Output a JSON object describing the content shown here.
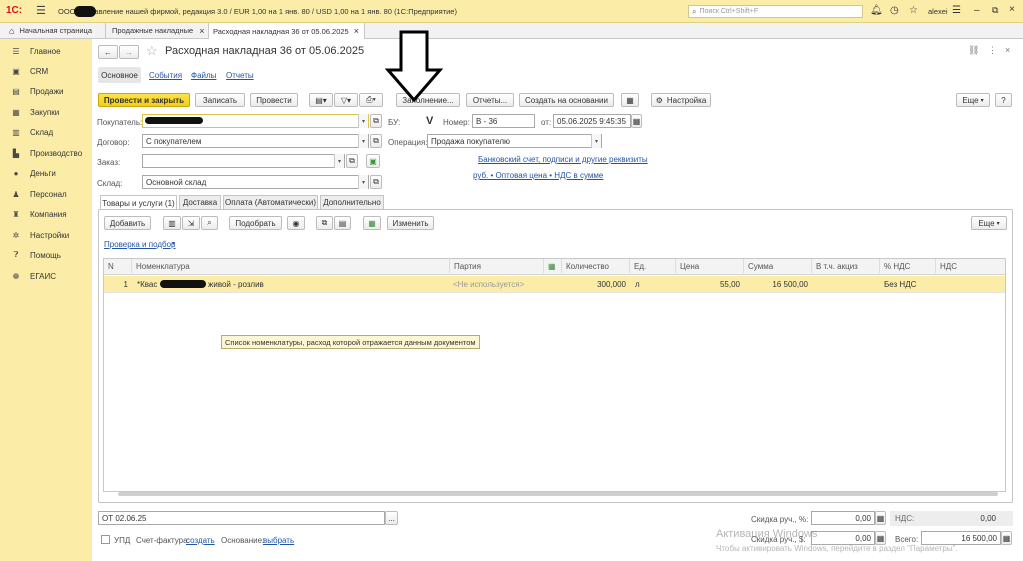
{
  "app": {
    "logo": "1С:",
    "title": "ООО  / Управление нашей фирмой, редакция 3.0 / EUR 1,00 на 1 янв. 80 / USD 1,00 на 1 янв. 80  (1С:Предприятие)",
    "search_placeholder": "Поиск Ctrl+Shift+F",
    "user": "alexei"
  },
  "tabs": [
    {
      "label": "Начальная страница"
    },
    {
      "label": "Продажные накладные"
    },
    {
      "label": "Расходная накладная 36 от 05.06.2025"
    }
  ],
  "sidebar": {
    "items": [
      {
        "label": "Главное",
        "icon": "menu-icon"
      },
      {
        "label": "CRM",
        "icon": "crm-icon"
      },
      {
        "label": "Продажи",
        "icon": "sales-icon"
      },
      {
        "label": "Закупки",
        "icon": "purchases-icon"
      },
      {
        "label": "Склад",
        "icon": "warehouse-icon"
      },
      {
        "label": "Производство",
        "icon": "production-icon"
      },
      {
        "label": "Деньги",
        "icon": "money-icon"
      },
      {
        "label": "Персонал",
        "icon": "staff-icon"
      },
      {
        "label": "Компания",
        "icon": "company-icon"
      },
      {
        "label": "Настройки",
        "icon": "settings-icon"
      },
      {
        "label": "Помощь",
        "icon": "help-icon"
      },
      {
        "label": "ЕГАИС",
        "icon": "egais-icon"
      }
    ]
  },
  "doc": {
    "title": "Расходная накладная 36 от 05.06.2025",
    "nav": {
      "main": "Основное",
      "events": "События",
      "files": "Файлы",
      "reports": "Отчеты"
    },
    "toolbar": {
      "post_close": "Провести и закрыть",
      "save": "Записать",
      "post": "Провести",
      "fill": "Заполнение...",
      "reports": "Отчеты...",
      "create_based": "Создать на основании",
      "settings": "Настройка",
      "more": "Еще",
      "help": "?"
    },
    "fields": {
      "buyer_label": "Покупатель:",
      "contract_label": "Договор:",
      "contract_value": "С покупателем",
      "order_label": "Заказ:",
      "warehouse_label": "Склад:",
      "warehouse_value": "Основной склад",
      "bu_label": "БУ:",
      "bu_check": "V",
      "number_label": "Номер:",
      "number_value": "В - 36",
      "date_label": "от:",
      "date_value": "05.06.2025  9:45:35",
      "operation_label": "Операция:",
      "operation_value": "Продажа покупателю",
      "bank_link": "Банковский счет, подписи и другие реквизиты",
      "price_link": "руб. • Оптовая цена • НДС в сумме"
    },
    "content_tabs": [
      {
        "label": "Товары и услуги (1)"
      },
      {
        "label": "Доставка"
      },
      {
        "label": "Оплата (Автоматически)"
      },
      {
        "label": "Дополнительно"
      }
    ],
    "table_toolbar": {
      "add": "Добавить",
      "pick": "Подобрать",
      "change": "Изменить",
      "more": "Еще",
      "check_link": "Проверка и подбор"
    },
    "table": {
      "headers": [
        "N",
        "Номенклатура",
        "Партия",
        "",
        "Количество",
        "Ед.",
        "Цена",
        "Сумма",
        "В т.ч. акциз",
        "% НДС",
        "НДС"
      ],
      "rows": [
        {
          "n": "1",
          "item": "*Квас",
          "item_rest": "живой - розлив",
          "batch": "<Не используется>",
          "qty": "300,000",
          "unit": "л",
          "price": "55,00",
          "sum": "16 500,00",
          "excise": "",
          "vat_rate": "Без НДС",
          "vat": ""
        }
      ]
    },
    "tooltip": "Список номенклатуры, расход которой отражается данным документом",
    "footer": {
      "comment": "ОТ 02.06.25",
      "upd_label": "УПД",
      "invoice_label": "Счет-фактура:",
      "invoice_link": "создать",
      "basis_label": "Основание:",
      "basis_link": "выбрать",
      "discount_pct_label": "Скидка руч., %:",
      "discount_pct_value": "0,00",
      "discount_sum_label": "Скидка руч., $:",
      "discount_sum_value": "0,00",
      "vat_label": "НДС:",
      "vat_value": "0,00",
      "total_label": "Всего:",
      "total_value": "16 500,00"
    },
    "watermark": {
      "line1": "Активация Windows",
      "line2": "Чтобы активировать Windows, перейдите в раздел \"Параметры\"."
    }
  }
}
